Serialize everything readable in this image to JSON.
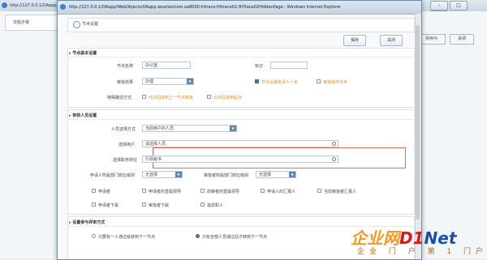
{
  "background_window": {
    "url": "http://127.0.0.1/OAapp/WebO",
    "side_title": "流程步骤",
    "buttons": [
      "另存为",
      "关闭"
    ]
  },
  "popup": {
    "title": "http://127.0.0.1/OAapp/WebObjects/OAapp.woa/wo/com.oa8000.httrace.Httrace02.HtTrace02HiddenPage - Windows Internet Explorer",
    "header_title": "节点设置",
    "toolbar": {
      "save": "保存",
      "close": "关闭"
    },
    "section_basic": {
      "title": "节点基本设置",
      "node_name_label": "节点名称",
      "node_name_value": "办公室",
      "mark_label": "标识",
      "mark_value": "",
      "approval_result_label": "审批结果",
      "approval_result_value": "办理",
      "opt_auto_next": "节点设置负责人一步",
      "opt_can_sign": "审批操作不步",
      "special_label": "特殊路径方式",
      "special_opt1": "允许回退到上一节点审批",
      "special_opt2": "允许回退到起点"
    },
    "section_approver": {
      "title": "审核人员设置",
      "method_label": "人员选择方式",
      "method_value": "当前用户的人员",
      "user_label": "选择用户",
      "user_value": "请选择人员",
      "position_label": "选择职务岗位",
      "position_value": "行政秘书",
      "dept_pos_label": "申请人所属部门岗位级别",
      "dept_pos_value": "无选择",
      "prev_pos_label": "审批者所属部门岗位级别",
      "prev_pos_value": "无选择",
      "checks": [
        "申请者",
        "申请者的直属领导",
        "前审者的直属领导",
        "申请人的汇报人",
        "当前审批者汇报人",
        "申请者下属",
        "审批者下属",
        "指定职人"
      ]
    },
    "section_method": {
      "title": "设置参与评审方式",
      "opt1": "只要有一人通过就转到下一节点",
      "opt2": "只有全部人员通过后才转到下一节点"
    }
  },
  "watermark": {
    "main": "企业网",
    "mid": "D1",
    "net": "Net",
    "sub": "企业 门 户 第 1 门户"
  },
  "colors": {
    "accent_blue": "#5d84b3",
    "highlight_red": "#e06a6a",
    "option_orange": "#e48a26",
    "watermark_orange": "#f29a1f",
    "watermark_red": "#d7191f",
    "watermark_blue": "#1a4fa8"
  }
}
